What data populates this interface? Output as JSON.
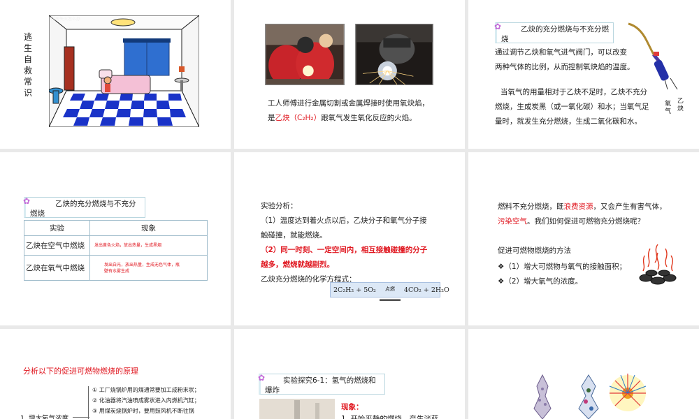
{
  "slide1": {
    "vertical_title": [
      "逃",
      "生",
      "自",
      "救",
      "常",
      "识"
    ]
  },
  "slide2": {
    "line1": "工人师傅进行金属切割或金属焊接时使用氧炔焰，",
    "line2_prefix": "是",
    "line2_red": "乙炔（C₂H₂）",
    "line2_suffix": "跟氧气发生氧化反应的火焰。"
  },
  "slide3": {
    "title": "乙炔的充分燃烧与不充分燃烧",
    "para1": [
      "通过调节乙炔和氧气进气阀门，可以改变",
      "两种气体的比例，从而控制氧炔焰的温度。"
    ],
    "para2": [
      "当氧气的用量相对于乙炔不足时，乙炔不充分",
      "燃烧，生成炭黑（或一氧化碳）和水；当氧气足",
      "量时，就发生充分燃烧，生成二氧化碳和水。"
    ],
    "label_oxygen": "氧气",
    "label_acetylene": "乙炔"
  },
  "slide4": {
    "title": "乙炔的充分燃烧与不充分燃烧",
    "headers": [
      "实验",
      "现象"
    ],
    "rows": [
      {
        "exp": "乙炔在空气中燃烧",
        "obs": "发出黄色火焰，放出热量，生成黑烟"
      },
      {
        "exp": "乙炔在氧气中燃烧",
        "obs": "发出白光，放出热量，生成无色气体，瓶壁有水雾生成"
      }
    ]
  },
  "slide5": {
    "heading": "实验分析：",
    "p1": [
      "（1）温度达到着火点以后，乙炔分子和氧气分子接",
      "触碰撞，就能燃烧。"
    ],
    "p2": [
      "（2）同一时刻、一定空间内，相互接触碰撞的分子",
      "越多，燃烧就越剧烈。"
    ],
    "p3": "乙炔充分燃烧的化学方程式：",
    "eq_left": "2C₂H₂ + 5O₂",
    "eq_cond": "点燃",
    "eq_right": "4CO₂ + 2H₂O"
  },
  "slide6": {
    "s1": "燃料不充分燃烧，既",
    "s1_red": "浪费资源",
    "s1_end": "，又会产生有害气体，",
    "s2_red": "污染空气",
    "s2_end": "。我们如何促进可燃物充分燃烧呢？",
    "methods_title": "促进可燃物燃烧的方法",
    "bullets": [
      "❖（1）增大可燃物与氧气的接触面积；",
      "❖（2）增大氧气的浓度。"
    ]
  },
  "slide7": {
    "heading": "分析以下的促进可燃物燃烧的原理",
    "items": [
      "① 工厂烧锅炉用的煤通常要加工成粉末状；",
      "② 化油器将汽油喷成雾状进入内燃机汽缸；",
      "③ 用煤炭烧锅炉时，要用鼓风机不断往锅"
    ],
    "left_label": "1. 增大氧气浓度"
  },
  "slide8": {
    "title": "实验探究6-1：氢气的燃烧和爆炸",
    "phenomenon": "现象：",
    "item1": "1. 开始平静的燃烧，产生淡蓝"
  }
}
